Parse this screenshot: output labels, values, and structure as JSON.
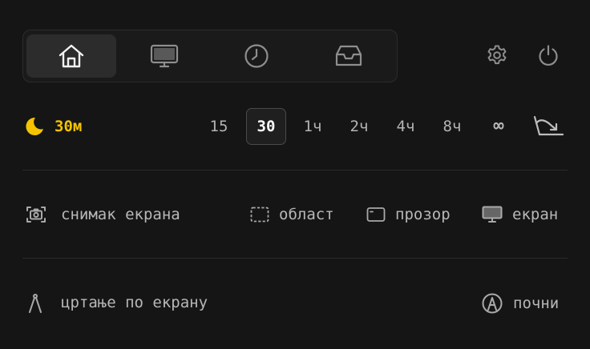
{
  "tabs": [
    {
      "icon": "home-icon",
      "active": true
    },
    {
      "icon": "display-icon",
      "active": false
    },
    {
      "icon": "clock-icon",
      "active": false
    },
    {
      "icon": "inbox-icon",
      "active": false
    }
  ],
  "toolbar": {
    "settings_icon": "gear-icon",
    "power_icon": "power-icon"
  },
  "timer": {
    "current": "30м",
    "durations": [
      "15",
      "30",
      "1ч",
      "2ч",
      "4ч",
      "8ч",
      "∞"
    ],
    "selected": "30",
    "accent": "#f5c400"
  },
  "capture": {
    "label": "снимак екрана",
    "options": {
      "area": "област",
      "window": "прозор",
      "screen": "екран"
    }
  },
  "draw": {
    "label": "цртање по екрану",
    "start": "почни"
  }
}
